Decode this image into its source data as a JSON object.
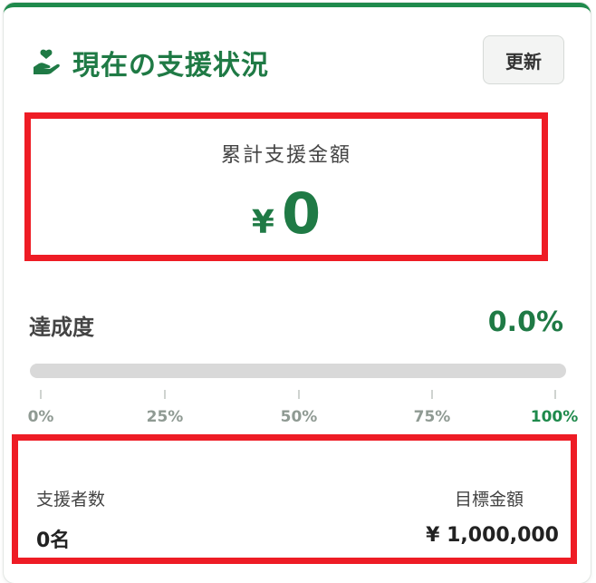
{
  "header": {
    "title": "現在の支援状況",
    "icon": "hand-heart-icon",
    "refresh_label": "更新"
  },
  "total": {
    "label": "累計支援金額",
    "currency": "¥",
    "amount": "0"
  },
  "progress": {
    "label": "達成度",
    "percent_text": "0.0%",
    "value": 0,
    "scale": [
      "0%",
      "25%",
      "50%",
      "75%",
      "100%"
    ]
  },
  "stats": {
    "supporters_label": "支援者数",
    "supporters_value": "0名",
    "goal_label": "目標金額",
    "goal_value": "¥ 1,000,000"
  },
  "colors": {
    "accent": "#1f7a45",
    "highlight": "#ee1c25"
  }
}
